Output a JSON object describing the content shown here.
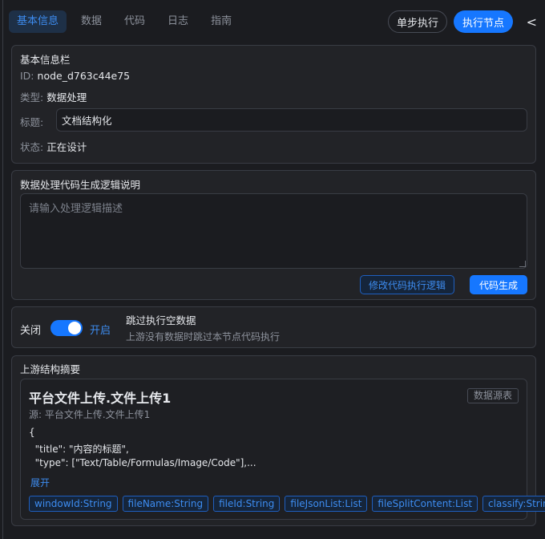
{
  "tabs": [
    {
      "label": "基本信息",
      "active": true
    },
    {
      "label": "数据"
    },
    {
      "label": "代码"
    },
    {
      "label": "日志"
    },
    {
      "label": "指南"
    }
  ],
  "header": {
    "step_label": "单步执行",
    "run_label": "执行节点",
    "collapse_glyph": "<"
  },
  "basic": {
    "title": "基本信息栏",
    "id_label": "ID:",
    "id_value": "node_d763c44e75",
    "type_label": "类型:",
    "type_value": "数据处理",
    "title_label": "标题:",
    "title_value": "文档结构化",
    "status_label": "状态:",
    "status_value": "正在设计"
  },
  "logic": {
    "title": "数据处理代码生成逻辑说明",
    "placeholder": "请输入处理逻辑描述",
    "modify_label": "修改代码执行逻辑",
    "generate_label": "代码生成"
  },
  "skip": {
    "off_label": "关闭",
    "on_label": "开启",
    "enabled": true,
    "title": "跳过执行空数据",
    "description": "上游没有数据时跳过本节点代码执行"
  },
  "upstream": {
    "title": "上游结构摘要",
    "name": "平台文件上传.文件上传1",
    "badge": "数据源表",
    "source": "源: 平台文件上传.文件上传1",
    "json_lines": [
      "{",
      "  \"title\": \"内容的标题\",",
      "  \"type\": [\"Text/Table/Formulas/Image/Code\"],..."
    ],
    "expand_label": "展开",
    "fields": [
      "windowId:String",
      "fileName:String",
      "fileId:String",
      "fileJsonList:List",
      "fileSplitContent:List",
      "classify:String"
    ]
  },
  "colors": {
    "accent": "#1677ff",
    "background": "#1b1c20",
    "panel": "#222327"
  }
}
